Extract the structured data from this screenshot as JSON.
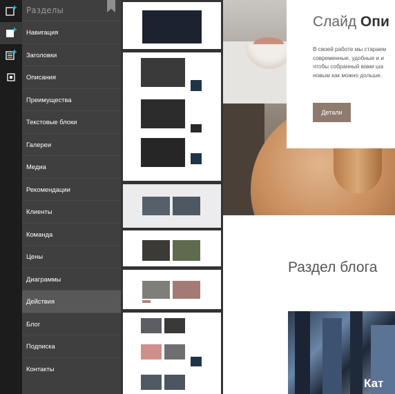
{
  "rail": {
    "items": [
      {
        "icon": "add-block-icon"
      },
      {
        "icon": "add-container-icon"
      },
      {
        "icon": "section-list-icon"
      },
      {
        "icon": "settings-box-icon"
      }
    ]
  },
  "panel": {
    "title": "Разделы",
    "active_index": 12,
    "sections": [
      "Навигация",
      "Заголовки",
      "Описания",
      "Преимущества",
      "Текстовые блоки",
      "Галереи",
      "Медиа",
      "Рекомендации",
      "Клиенты",
      "Команда",
      "Цены",
      "Диаграммы",
      "Действия",
      "Блог",
      "Подписка",
      "Контакты"
    ]
  },
  "preview": {
    "slide_title_light": "Слайд ",
    "slide_title_bold": "Опи",
    "slide_lines": [
      "В своей работе мы стараем",
      "современные, удобные и и",
      "чтобы собранный вами ша",
      "новым как можно дольше."
    ],
    "details_button": "Детали",
    "blog_title": "Раздел блога",
    "blog_image_caption": "Кат"
  },
  "colors": {
    "rail_bg": "#1c1c1c",
    "panel_bg": "#3f3f3f",
    "active_item_bg": "#585858",
    "button_bg": "#8f7a6e"
  }
}
